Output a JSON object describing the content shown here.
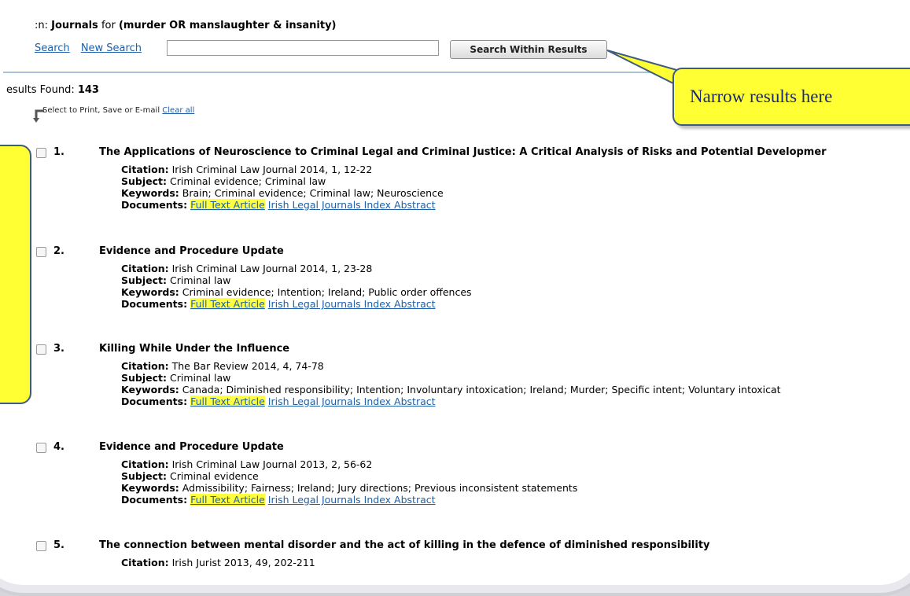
{
  "header": {
    "search_prefix": ":n:",
    "search_scope": "Journals",
    "for_label": "for",
    "search_query": "(murder OR manslaughter & insanity)",
    "links": [
      "Search",
      "New Search"
    ],
    "search_within_value": "",
    "search_within_button": "Search Within Results"
  },
  "results_found_label": "esults Found:",
  "results_found_count": "143",
  "print_bar": {
    "label": "Select to Print, Save or E-mail",
    "clear_all": "Clear all"
  },
  "callout": {
    "text": "Narrow results here",
    "color": "#ffff33"
  },
  "results": [
    {
      "num": "1.",
      "title": "The Applications of Neuroscience to Criminal Legal and Criminal Justice: A Critical Analysis of Risks and Potential Developmer",
      "citation_label": "Citation:",
      "citation": "Irish Criminal Law Journal 2014, 1, 12-22",
      "subject_label": "Subject:",
      "subject": "Criminal evidence; Criminal law",
      "keywords_label": "Keywords:",
      "keywords": "Brain; Criminal evidence; Criminal law; Neuroscience",
      "documents_label": "Documents:",
      "doc_full": "Full Text Article",
      "doc_abstract": "Irish Legal Journals Index Abstract"
    },
    {
      "num": "2.",
      "title": "Evidence and Procedure Update",
      "citation_label": "Citation:",
      "citation": "Irish Criminal Law Journal 2014, 1, 23-28",
      "subject_label": "Subject:",
      "subject": "Criminal law",
      "keywords_label": "Keywords:",
      "keywords": "Criminal evidence; Intention; Ireland; Public order offences",
      "documents_label": "Documents:",
      "doc_full": "Full Text Article",
      "doc_abstract": "Irish Legal Journals Index Abstract"
    },
    {
      "num": "3.",
      "title": "Killing While Under the Influence",
      "citation_label": "Citation:",
      "citation": "The Bar Review 2014, 4, 74-78",
      "subject_label": "Subject:",
      "subject": "Criminal law",
      "keywords_label": "Keywords:",
      "keywords": "Canada; Diminished responsibility; Intention; Involuntary intoxication; Ireland; Murder; Specific intent; Voluntary intoxicat",
      "documents_label": "Documents:",
      "doc_full": "Full Text Article",
      "doc_abstract": "Irish Legal Journals Index Abstract"
    },
    {
      "num": "4.",
      "title": "Evidence and Procedure Update",
      "citation_label": "Citation:",
      "citation": "Irish Criminal Law Journal 2013, 2, 56-62",
      "subject_label": "Subject:",
      "subject": "Criminal evidence",
      "keywords_label": "Keywords:",
      "keywords": "Admissibility; Fairness; Ireland; Jury directions; Previous inconsistent statements",
      "documents_label": "Documents:",
      "doc_full": "Full Text Article",
      "doc_abstract": "Irish Legal Journals Index Abstract"
    },
    {
      "num": "5.",
      "title": "The connection between mental disorder and the act of killing in the defence of diminished responsibility",
      "citation_label": "Citation:",
      "citation": "Irish Jurist 2013, 49, 202-211"
    }
  ]
}
